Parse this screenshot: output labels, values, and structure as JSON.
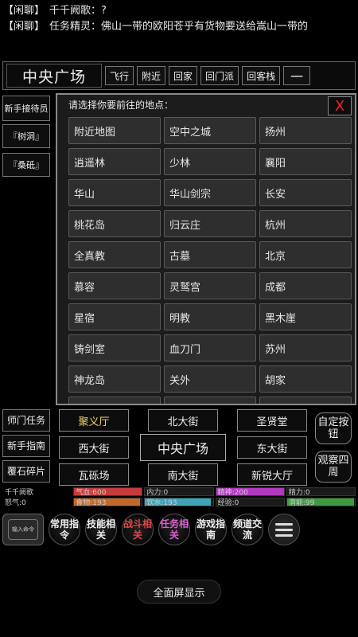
{
  "chat": [
    {
      "channel": "【闲聊】",
      "text": "千千阙歌：?"
    },
    {
      "channel": "【闲聊】",
      "text": "任务精灵：佛山一带的欧阳苍乎有货物要送给嵩山一带的"
    }
  ],
  "location": {
    "title": "中央广场",
    "buttons": [
      "飞行",
      "附近",
      "回家",
      "回门派",
      "回客栈"
    ],
    "minimize": "一"
  },
  "side_buttons": [
    "新手接待员",
    "『树洞』",
    "『桑砥』"
  ],
  "dialog": {
    "title": "请选择你要前往的地点：",
    "close": "X",
    "destinations": [
      "附近地图",
      "空中之城",
      "扬州",
      "逍遥林",
      "少林",
      "襄阳",
      "华山",
      "华山剑宗",
      "长安",
      "桃花岛",
      "归云庄",
      "杭州",
      "全真教",
      "古墓",
      "北京",
      "慕容",
      "灵鹫宫",
      "成都",
      "星宿",
      "明教",
      "黑木崖",
      "铸剑室",
      "血刀门",
      "苏州",
      "神龙岛",
      "关外",
      "胡家",
      "",
      "",
      ""
    ]
  },
  "map_nav": {
    "left": [
      "师门任务",
      "新手指南",
      "覆石碎片"
    ],
    "north_west": "聚义厅",
    "north": "北大街",
    "north_east": "圣贤堂",
    "west": "西大街",
    "center": "中央广场",
    "east": "东大街",
    "south_west": "瓦砾场",
    "south": "南大街",
    "south_east": "新锐大厅",
    "right": [
      "自定按钮",
      "观察四周"
    ]
  },
  "stats": {
    "name": "千千阙歌",
    "anger": "怒气:0",
    "qixue": {
      "label": "气血:600",
      "fill": 1.0,
      "color": "#c43c3c"
    },
    "neili": {
      "label": "内力:0",
      "fill": 0.0,
      "color": "#3b6fd0"
    },
    "jingshen": {
      "label": "精神:200",
      "fill": 1.0,
      "color": "#b13ac0"
    },
    "jingli": {
      "label": "精力:0",
      "fill": 0.0,
      "color": "#c2a83a"
    },
    "shiwu": {
      "label": "食物:193",
      "fill": 0.97,
      "color": "#c4682a"
    },
    "yinshui": {
      "label": "饮水:193",
      "fill": 0.97,
      "color": "#3fa4b8"
    },
    "jingyan": {
      "label": "经验:0",
      "fill": 0.0,
      "color": "#7a7a7a"
    },
    "qianneng": {
      "label": "潜能:99",
      "fill": 0.99,
      "color": "#3e9a3e"
    }
  },
  "nav": {
    "thumb_label": "输入命令",
    "buttons": [
      "常用指令",
      "技能相关",
      "战斗相关",
      "任务相关",
      "游戏指南",
      "频道交流"
    ]
  },
  "fullscreen": "全面屏显示"
}
